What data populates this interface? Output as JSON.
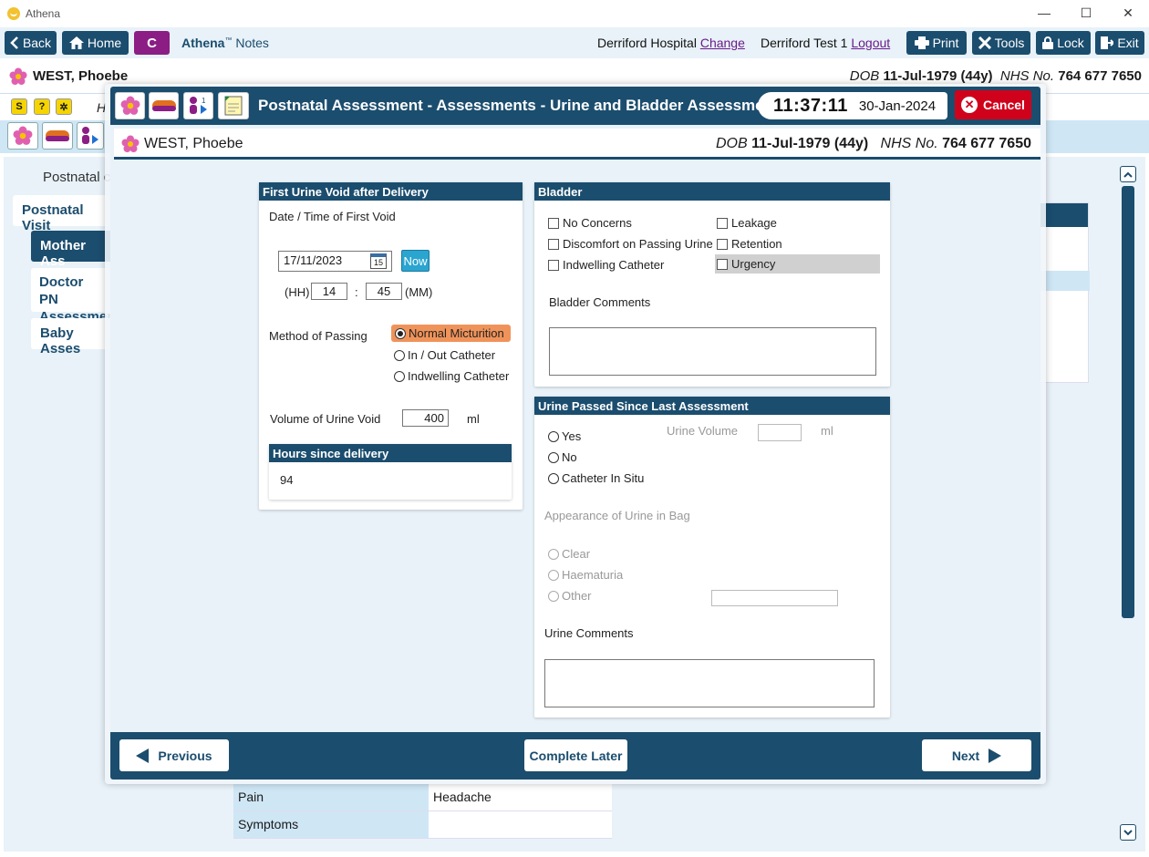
{
  "window": {
    "app_title": "Athena",
    "minimize": "—",
    "maximize": "☐",
    "close": "✕"
  },
  "toolbar": {
    "back": "Back",
    "home": "Home",
    "c": "C",
    "brand_name": "Athena",
    "brand_tm": "™",
    "brand_suffix": " Notes",
    "hospital": "Derriford Hospital",
    "change": "Change",
    "user": "Derriford Test 1",
    "logout": "Logout",
    "print": "Print",
    "tools": "Tools",
    "lock": "Lock",
    "exit": "Exit"
  },
  "patient": {
    "name": "WEST, Phoebe",
    "dob_label": "DOB",
    "dob": "11-Jul-1979 (44y)",
    "nhs_label": "NHS No.",
    "nhs": "764 677 7650"
  },
  "background": {
    "row2_letter": "H",
    "left_title": "Postnatal c",
    "nav": [
      "Postnatal Visit",
      "Mother Ass",
      "Doctor PN",
      "Assessmen",
      "Baby Asses"
    ],
    "table": [
      {
        "key": "Pain",
        "value": "Headache"
      },
      {
        "key": "Symptoms",
        "value": ""
      }
    ]
  },
  "modal": {
    "title": "Postnatal Assessment - Assessments - Urine and Bladder Assessment",
    "time": "11:37:11",
    "date": "30-Jan-2024",
    "cancel": "Cancel",
    "first_void": {
      "header": "First Urine Void after Delivery",
      "datetime_label": "Date / Time of First Void",
      "date_value": "17/11/2023",
      "calendar_day": "15",
      "now": "Now",
      "hh_label": "(HH)",
      "hh_value": "14",
      "sep": ":",
      "mm_value": "45",
      "mm_label": "(MM)",
      "method_label": "Method of Passing",
      "method_options": [
        "Normal Micturition",
        "In / Out Catheter",
        "Indwelling Catheter"
      ],
      "method_selected": 0,
      "volume_label": "Volume of Urine Void",
      "volume_value": "400",
      "volume_unit": "ml",
      "hours_header": "Hours since delivery",
      "hours_value": "94"
    },
    "bladder": {
      "header": "Bladder",
      "options": [
        "No Concerns",
        "Leakage",
        "Discomfort on Passing Urine",
        "Retention",
        "Indwelling Catheter",
        "Urgency"
      ],
      "comments_label": "Bladder Comments"
    },
    "urine": {
      "header": "Urine Passed Since Last Assessment",
      "options": [
        "Yes",
        "No",
        "Catheter In Situ"
      ],
      "volume_label": "Urine Volume",
      "volume_unit": "ml",
      "appearance_label": "Appearance of Urine in Bag",
      "appearance_options": [
        "Clear",
        "Haematuria",
        "Other"
      ],
      "comments_label": "Urine Comments"
    },
    "footer": {
      "previous": "Previous",
      "complete_later": "Complete Later",
      "next": "Next"
    }
  },
  "colors": {
    "primary": "#1b4d6e",
    "accent_c": "#8b1d85",
    "cancel": "#d0011b",
    "selected_option": "#f0935a",
    "now_button": "#2aa5d0"
  }
}
